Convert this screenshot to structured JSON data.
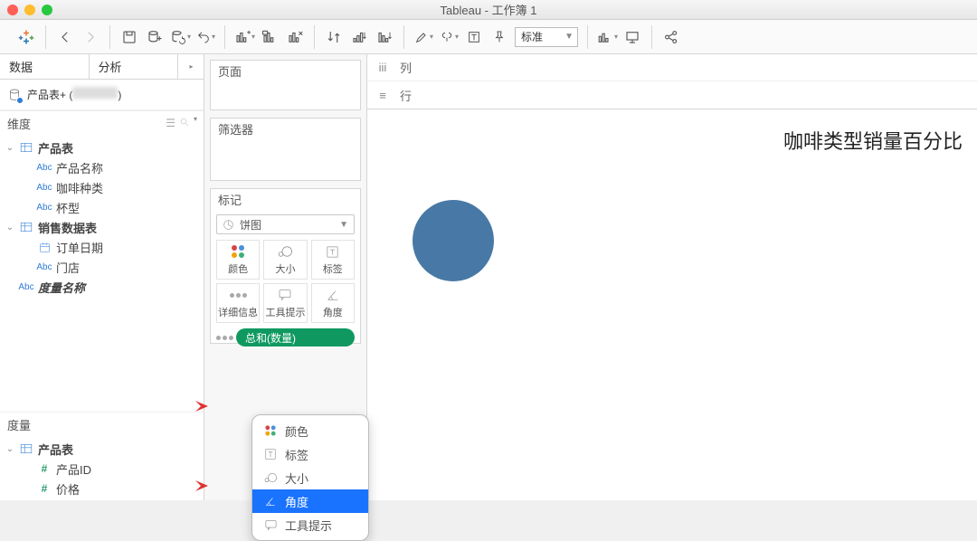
{
  "window": {
    "title": "Tableau - 工作簿 1"
  },
  "toolbar": {
    "fit_label": "标准"
  },
  "left": {
    "tabs": {
      "data": "数据",
      "analytics": "分析"
    },
    "datasource": {
      "prefix": "产品表+ (",
      "suffix": ")"
    },
    "dims_head": "维度",
    "meas_head": "度量",
    "tables": {
      "prod": {
        "name": "产品表",
        "f1": "产品名称",
        "f2": "咖啡种类",
        "f3": "杯型"
      },
      "sales": {
        "name": "销售数据表",
        "f1": "订单日期",
        "f2": "门店"
      },
      "measure_names": "度量名称",
      "prod_m": {
        "name": "产品表",
        "f1": "产品ID",
        "f2": "价格"
      }
    }
  },
  "mid": {
    "pages": "页面",
    "filters": "筛选器",
    "marks": "标记",
    "mark_type": "饼图",
    "cells": {
      "color": "颜色",
      "size": "大小",
      "label": "标签",
      "detail": "详细信息",
      "tooltip": "工具提示",
      "angle": "角度"
    },
    "pill": "总和(数量)"
  },
  "context_menu": {
    "color": "颜色",
    "label": "标签",
    "size": "大小",
    "angle": "角度",
    "tooltip": "工具提示"
  },
  "shelves": {
    "cols": "列",
    "rows": "行"
  },
  "viz": {
    "title": "咖啡类型销量百分比"
  }
}
